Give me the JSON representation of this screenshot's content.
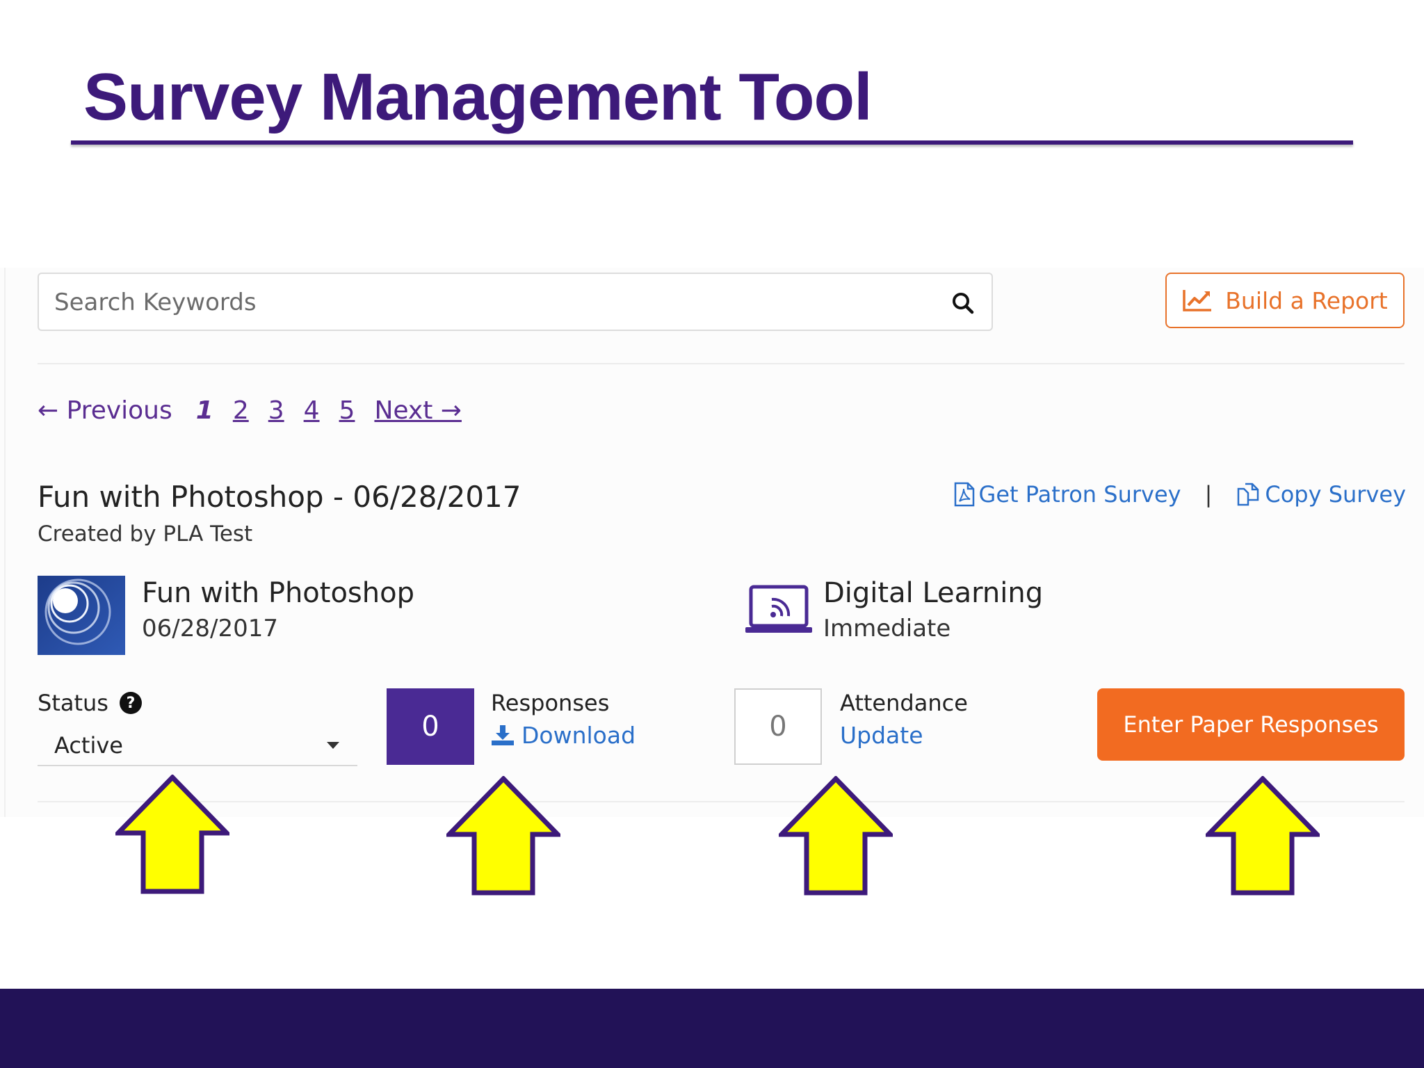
{
  "slide": {
    "title": "Survey Management Tool"
  },
  "search": {
    "placeholder": "Search Keywords"
  },
  "toolbar": {
    "build_report_label": "Build a Report"
  },
  "pagination": {
    "previous_label": "← Previous",
    "pages": [
      "1",
      "2",
      "3",
      "4",
      "5"
    ],
    "current_page": "1",
    "next_label": "Next →"
  },
  "survey": {
    "title": "Fun with Photoshop - 06/28/2017",
    "created_by": "Created by PLA Test",
    "get_patron_survey_label": "Get Patron Survey",
    "separator": "|",
    "copy_survey_label": "Copy Survey",
    "event_name": "Fun with Photoshop",
    "event_date": "06/28/2017",
    "category_name": "Digital Learning",
    "category_timing": "Immediate",
    "status_label": "Status",
    "status_help": "?",
    "status_value": "Active",
    "responses_count": "0",
    "responses_label": "Responses",
    "download_label": "Download",
    "attendance_count": "0",
    "attendance_label": "Attendance",
    "update_label": "Update",
    "enter_paper_label": "Enter Paper Responses"
  },
  "colors": {
    "title_purple": "#3d1a7a",
    "link_blue": "#2a6fc9",
    "accent_orange": "#f26b21",
    "responses_purple": "#4a2a94",
    "arrow_yellow": "#ffff00",
    "footer_navy": "#221257"
  },
  "icons": {
    "report": "line-chart-icon",
    "search": "magnifier-icon",
    "pdf": "pdf-file-icon",
    "copy": "copy-icon",
    "download": "download-icon",
    "category": "laptop-broadcast-icon",
    "callout": "up-arrow-icon"
  }
}
